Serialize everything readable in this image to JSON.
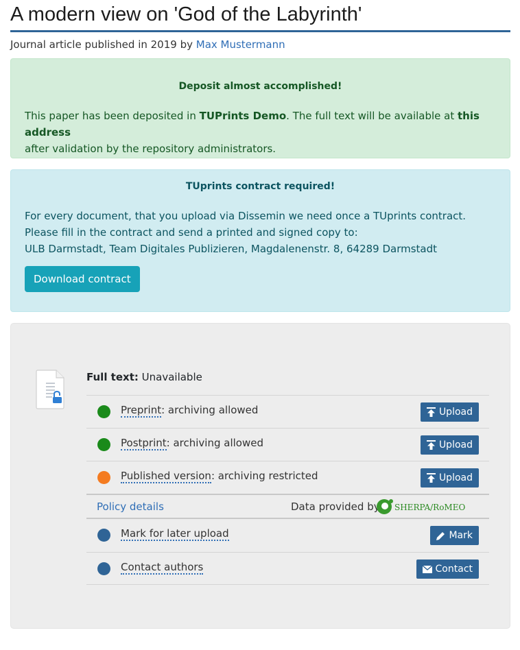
{
  "title": "A modern view on 'God of the Labyrinth'",
  "byline": {
    "prefix": "Journal article published in 2019 by",
    "author": "Max Mustermann"
  },
  "success_alert": {
    "heading": "Deposit almost accomplished!",
    "text_1": "This paper has been deposited in ",
    "repo": "TUPrints Demo",
    "text_2": ". The full text will be available at ",
    "address": "this address",
    "text_3": "after validation by the repository administrators."
  },
  "info_alert": {
    "heading": "TUprints contract required!",
    "text": "For every document, that you upload via Dissemin we need once a TUprints contract. Please fill in the contract and send a printed and signed copy to:",
    "address": "ULB Darmstadt, Team Digitales Publizieren, Magdalenenstr. 8, 64289 Darmstadt",
    "button": "Download contract"
  },
  "card": {
    "fulltext_label": "Full text:",
    "fulltext_value": "Unavailable",
    "rows": [
      {
        "term": "Preprint",
        "status": ": archiving allowed",
        "dot": "#1a8a1a",
        "button": "Upload",
        "icon": "upload-icon"
      },
      {
        "term": "Postprint",
        "status": ": archiving allowed",
        "dot": "#1a8a1a",
        "button": "Upload",
        "icon": "upload-icon"
      },
      {
        "term": "Published version",
        "status": ": archiving restricted",
        "dot": "#f47b20",
        "button": "Upload",
        "icon": "upload-icon"
      }
    ],
    "policy_link": "Policy details",
    "provided_by": "Data provided by",
    "romeo_logo": "SHERPA/RoMEO",
    "actions": [
      {
        "term": "Mark for later upload",
        "dot": "#2f6496",
        "button": "Mark",
        "icon": "pencil-icon"
      },
      {
        "term": "Contact authors",
        "dot": "#2f6496",
        "button": "Contact",
        "icon": "envelope-icon"
      }
    ]
  },
  "colors": {
    "primary": "#2f6496",
    "link": "#2f6eb6",
    "success_bg": "#d4edda",
    "info_bg": "#d1ecf1",
    "info_button": "#17a2b8"
  }
}
